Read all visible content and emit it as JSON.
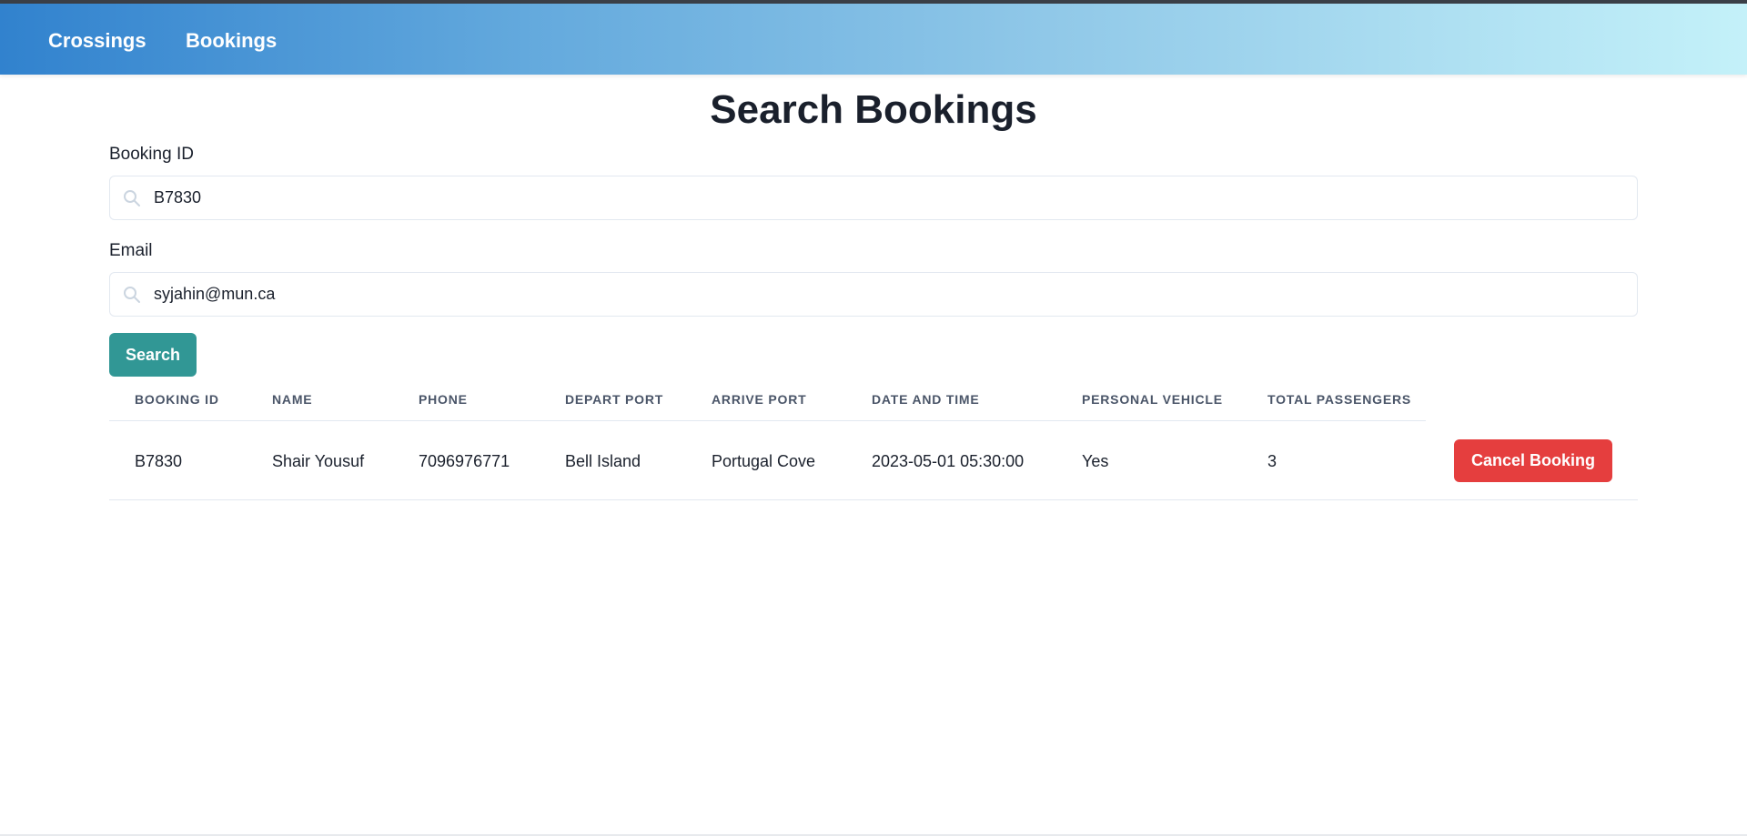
{
  "nav": {
    "items": [
      {
        "label": "Crossings"
      },
      {
        "label": "Bookings"
      }
    ]
  },
  "page": {
    "title": "Search Bookings"
  },
  "form": {
    "booking_id": {
      "label": "Booking ID",
      "value": "B7830",
      "icon": "search-icon"
    },
    "email": {
      "label": "Email",
      "value": "syjahin@mun.ca",
      "icon": "search-icon"
    },
    "search_label": "Search"
  },
  "table": {
    "columns": [
      "Booking ID",
      "Name",
      "Phone",
      "Depart Port",
      "Arrive Port",
      "Date and Time",
      "Personal Vehicle",
      "Total Passengers"
    ],
    "rows": [
      {
        "booking_id": "B7830",
        "name": "Shair Yousuf",
        "phone": "7096976771",
        "depart_port": "Bell Island",
        "arrive_port": "Portugal Cove",
        "date_time": "2023-05-01 05:30:00",
        "personal_vehicle": "Yes",
        "total_passengers": "3",
        "action_label": "Cancel Booking"
      }
    ]
  },
  "colors": {
    "search_button": "#319795",
    "cancel_button": "#e53e3e",
    "nav_gradient_start": "#3182ce",
    "nav_gradient_end": "#c4f1f9"
  }
}
